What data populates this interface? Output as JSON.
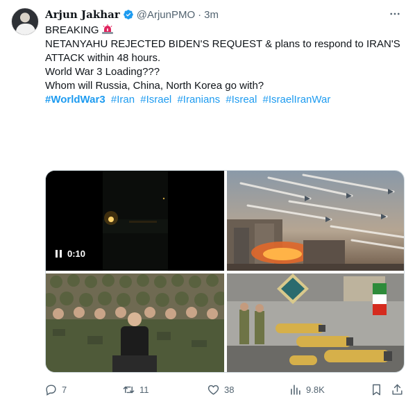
{
  "author": {
    "name": "Arjun Jakhar",
    "handle": "@ArjunPMO",
    "time": "3m",
    "separator": "·"
  },
  "tweet": {
    "lines": [
      "BREAKING",
      "NETANYAHU REJECTED BIDEN'S REQUEST & plans to respond to IRAN'S ATTACK within 48 hours.",
      "World War 3 Loading???",
      "Whom will Russia, China, North Korea go with?"
    ],
    "hashtags": [
      "#WorldWar3",
      "#Iran",
      "#Israel",
      "#Iranians",
      "#Isreal",
      "#IsraelIranWar"
    ]
  },
  "media": {
    "video_time": "0:10"
  },
  "actions": {
    "replies": "7",
    "retweets": "11",
    "likes": "38",
    "views": "9.8K"
  },
  "colors": {
    "accent": "#1d9bf0",
    "muted": "#536471",
    "text": "#0f1419",
    "verified": "#1d9bf0",
    "siren": "#e0245e"
  },
  "icons": [
    "more-icon",
    "verified-icon",
    "siren-icon",
    "pause-icon",
    "reply-icon",
    "retweet-icon",
    "like-icon",
    "views-icon",
    "bookmark-icon",
    "share-icon"
  ]
}
